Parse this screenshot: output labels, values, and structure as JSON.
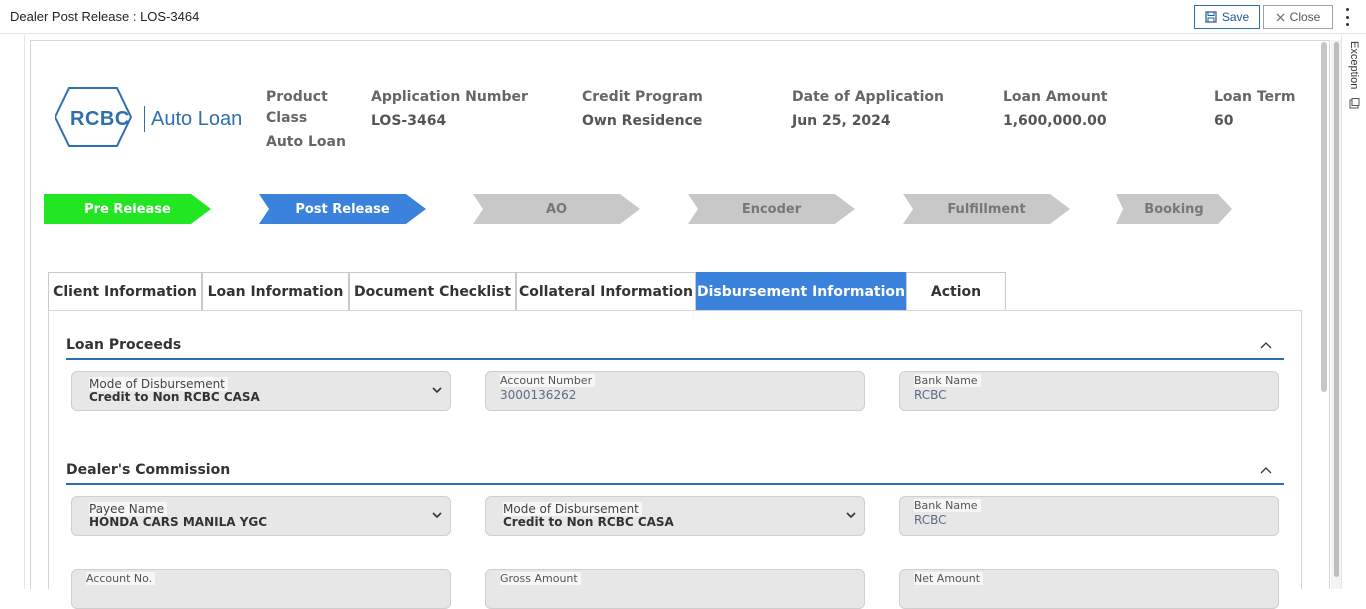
{
  "window": {
    "title": "Dealer Post Release : LOS-3464",
    "save_label": "Save",
    "close_label": "Close",
    "exception_label": "Exception"
  },
  "logo": {
    "brand": "RCBC",
    "product": "Auto Loan"
  },
  "header": {
    "product_label": "Product",
    "class_label": "Class",
    "class_value": "Auto Loan",
    "application_number_label": "Application Number",
    "application_number_value": "LOS-3464",
    "credit_program_label": "Credit Program",
    "credit_program_value": "Own Residence",
    "date_of_application_label": "Date of Application",
    "date_of_application_value": "Jun 25, 2024",
    "loan_amount_label": "Loan Amount",
    "loan_amount_value": "1,600,000.00",
    "loan_term_label": "Loan Term",
    "loan_term_value": "60"
  },
  "steps": [
    {
      "label": "Pre Release",
      "state": "done",
      "color": "#22e622"
    },
    {
      "label": "Post Release",
      "state": "current",
      "color": "#3b82dc"
    },
    {
      "label": "AO",
      "state": "pending",
      "color": "#c8c8c8"
    },
    {
      "label": "Encoder",
      "state": "pending",
      "color": "#c8c8c8"
    },
    {
      "label": "Fulfillment",
      "state": "pending",
      "color": "#c8c8c8"
    },
    {
      "label": "Booking",
      "state": "pending",
      "color": "#c8c8c8"
    }
  ],
  "tabs": [
    {
      "label": "Client Information"
    },
    {
      "label": "Loan Information"
    },
    {
      "label": "Document Checklist"
    },
    {
      "label": "Collateral Information"
    },
    {
      "label": "Disbursement Information",
      "active": true
    },
    {
      "label": "Action"
    }
  ],
  "loan_proceeds": {
    "title": "Loan Proceeds",
    "mode_label": "Mode of Disbursement",
    "mode_value": "Credit to Non RCBC CASA",
    "account_number_label": "Account Number",
    "account_number_value": "3000136262",
    "bank_name_label": "Bank Name",
    "bank_name_value": "RCBC"
  },
  "dealers_commission": {
    "title": "Dealer's Commission",
    "payee_label": "Payee Name",
    "payee_value": "HONDA CARS MANILA YGC",
    "mode_label": "Mode of Disbursement",
    "mode_value": "Credit to Non RCBC CASA",
    "bank_name_label": "Bank Name",
    "bank_name_value": "RCBC",
    "account_no_label": "Account No.",
    "gross_amount_label": "Gross Amount",
    "net_amount_label": "Net Amount"
  },
  "colors": {
    "accent": "#2e6fae",
    "active_tab": "#3b82dc",
    "done_step": "#22e622",
    "pending_step": "#c8c8c8"
  }
}
